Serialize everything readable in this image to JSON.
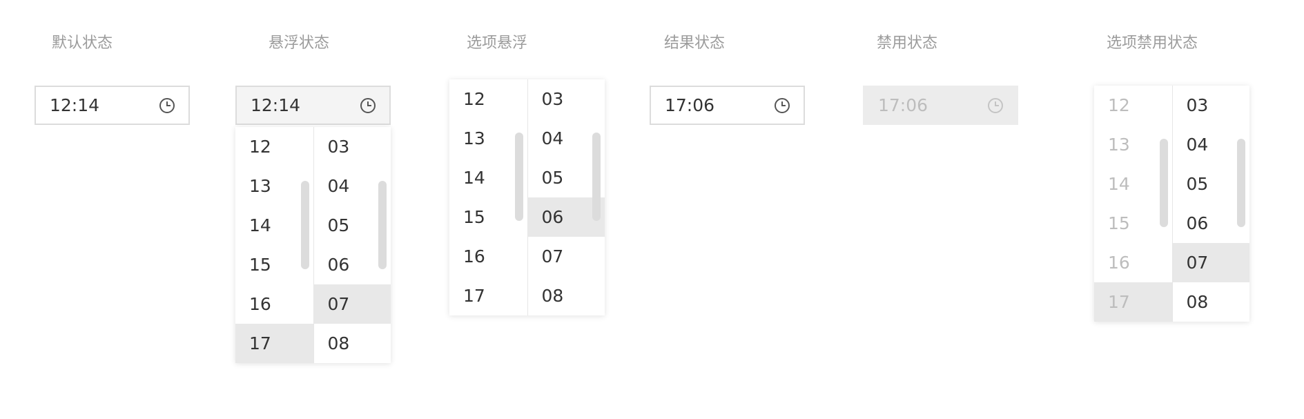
{
  "labels": {
    "default": "默认状态",
    "hover": "悬浮状态",
    "option_hover": "选项悬浮",
    "result": "结果状态",
    "disabled": "禁用状态",
    "option_disabled": "选项禁用状态"
  },
  "inputs": {
    "default": "12:14",
    "hover": "12:14",
    "result": "17:06",
    "disabled": "17:06"
  },
  "panels": {
    "hover": {
      "hours": [
        "12",
        "13",
        "14",
        "15",
        "16",
        "17"
      ],
      "minutes": [
        "03",
        "04",
        "05",
        "06",
        "07",
        "08"
      ],
      "selected_hour": "17",
      "selected_minute": "07"
    },
    "option_hover": {
      "hours": [
        "12",
        "13",
        "14",
        "15",
        "16",
        "17"
      ],
      "minutes": [
        "03",
        "04",
        "05",
        "06",
        "07",
        "08"
      ],
      "hovered_minute": "06"
    },
    "option_disabled": {
      "hours": [
        "12",
        "13",
        "14",
        "15",
        "16",
        "17"
      ],
      "minutes": [
        "03",
        "04",
        "05",
        "06",
        "07",
        "08"
      ],
      "selected_hour": "17",
      "selected_minute": "07",
      "hours_disabled": true
    }
  },
  "icons": {
    "clock": "clock-icon"
  },
  "colors": {
    "label": "#9b9b9b",
    "text": "#333333",
    "border": "#dcdcdc",
    "selected_bg": "#e8e8e8",
    "disabled_bg": "#ececec",
    "disabled_text": "#bdbdbd"
  }
}
